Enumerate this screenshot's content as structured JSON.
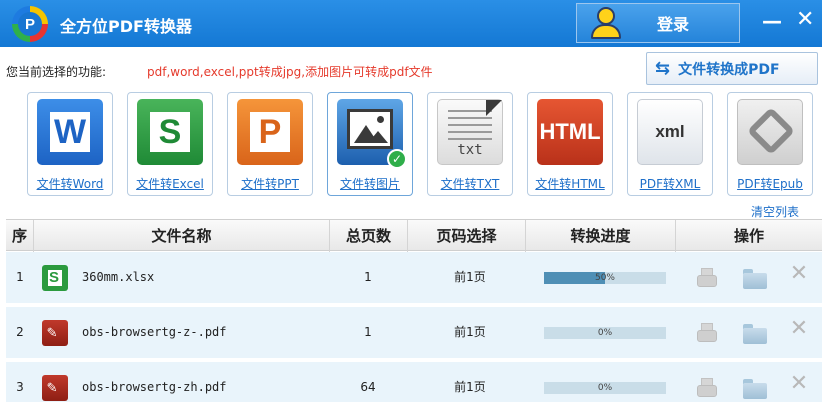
{
  "window": {
    "title": "全方位PDF转换器",
    "login_label": "登录",
    "minimize_label": "—",
    "close_label": "✕"
  },
  "function_bar": {
    "label": "您当前选择的功能:",
    "description": "pdf,word,excel,ppt转成jpg,添加图片可转成pdf文件",
    "convert_button": "文件转换成PDF"
  },
  "tools": [
    {
      "label": "文件转Word",
      "icon": "word-icon",
      "letter": "W"
    },
    {
      "label": "文件转Excel",
      "icon": "excel-icon",
      "letter": "S"
    },
    {
      "label": "文件转PPT",
      "icon": "ppt-icon",
      "letter": "P"
    },
    {
      "label": "文件转图片",
      "icon": "image-icon",
      "selected": true
    },
    {
      "label": "文件转TXT",
      "icon": "txt-icon",
      "tile_text": "txt"
    },
    {
      "label": "文件转HTML",
      "icon": "html-icon",
      "tile_text": "HTML"
    },
    {
      "label": "PDF转XML",
      "icon": "xml-icon",
      "tile_text": "xml"
    },
    {
      "label": "PDF转Epub",
      "icon": "epub-icon"
    }
  ],
  "clear_list_label": "清空列表",
  "table": {
    "headers": [
      "序",
      "文件名称",
      "总页数",
      "页码选择",
      "转换进度",
      "操作"
    ],
    "rows": [
      {
        "index": "1",
        "file_type": "excel",
        "name": "360mm.xlsx",
        "pages": "1",
        "range": "前1页",
        "progress": 50,
        "progress_label": "50%"
      },
      {
        "index": "2",
        "file_type": "pdf",
        "name": "obs-browsertg-z-.pdf",
        "pages": "1",
        "range": "前1页",
        "progress": 0,
        "progress_label": "0%"
      },
      {
        "index": "3",
        "file_type": "pdf",
        "name": "obs-browsertg-zh.pdf",
        "pages": "64",
        "range": "前1页",
        "progress": 0,
        "progress_label": "0%"
      }
    ]
  },
  "colors": {
    "title_bar": "#1478d4",
    "accent_blue": "#1e6fc9",
    "description_red": "#e53a2c",
    "row_bg": "#e9f4fb",
    "progress_fill": "#4f8fb5"
  }
}
